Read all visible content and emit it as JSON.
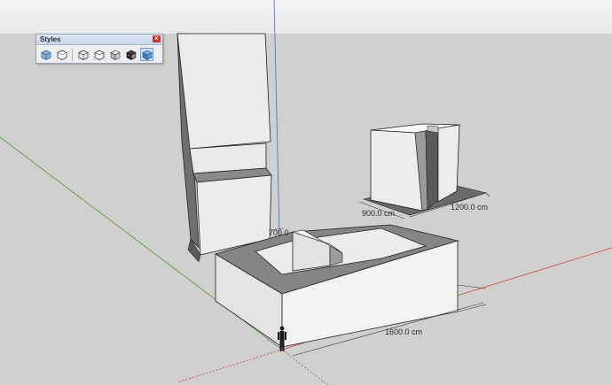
{
  "styles_toolbar": {
    "title": "Styles",
    "close_label": "x",
    "tools": [
      {
        "name": "x-ray-icon"
      },
      {
        "name": "back-edges-icon"
      },
      {
        "name": "wireframe-icon"
      },
      {
        "name": "hidden-line-icon"
      },
      {
        "name": "shaded-icon"
      },
      {
        "name": "shaded-with-textures-icon"
      },
      {
        "name": "monochrome-icon",
        "active": true
      }
    ]
  },
  "dimensions": {
    "depth_small_block": "1200.0 cm",
    "width_small_block": "900.0 cm",
    "height_low_block": "700.0",
    "length_large_block": "1600.0 cm"
  },
  "colors": {
    "red_axis": "#d8403c",
    "green_axis": "#4c9a3c",
    "blue_axis": "#3f6fd6"
  }
}
